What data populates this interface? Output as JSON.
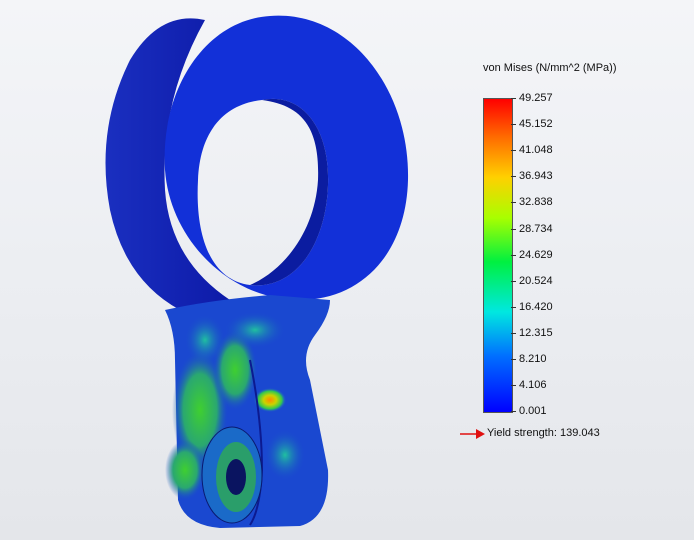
{
  "legend": {
    "title": "von Mises (N/mm^2 (MPa))",
    "ticks": [
      "49.257",
      "45.152",
      "41.048",
      "36.943",
      "32.838",
      "28.734",
      "24.629",
      "20.524",
      "16.420",
      "12.315",
      "8.210",
      "4.106",
      "0.001"
    ],
    "colors": [
      "#ff0000",
      "#ff7f00",
      "#ffd000",
      "#b4ff00",
      "#00ff30",
      "#00ffd0",
      "#0060ff",
      "#0000ff"
    ]
  },
  "yield": {
    "label": "Yield strength: 139.043",
    "arrow_color": "#e01010"
  }
}
